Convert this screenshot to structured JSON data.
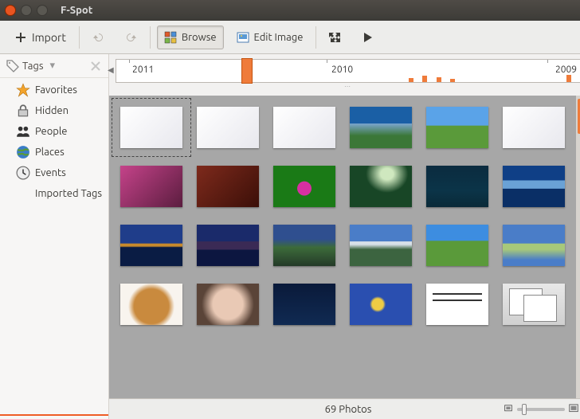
{
  "window": {
    "title": "F-Spot"
  },
  "toolbar": {
    "import_label": "Import",
    "browse_label": "Browse",
    "edit_label": "Edit Image"
  },
  "sidebar": {
    "header": "Tags",
    "items": [
      {
        "label": "Favorites",
        "icon": "star"
      },
      {
        "label": "Hidden",
        "icon": "lock"
      },
      {
        "label": "People",
        "icon": "people"
      },
      {
        "label": "Places",
        "icon": "globe"
      },
      {
        "label": "Events",
        "icon": "clock"
      },
      {
        "label": "Imported Tags",
        "icon": "none"
      }
    ]
  },
  "timeline": {
    "labels": [
      "2011",
      "2010",
      "2009"
    ],
    "slider_pos_pct": 27
  },
  "status": {
    "count_label": "69 Photos"
  }
}
